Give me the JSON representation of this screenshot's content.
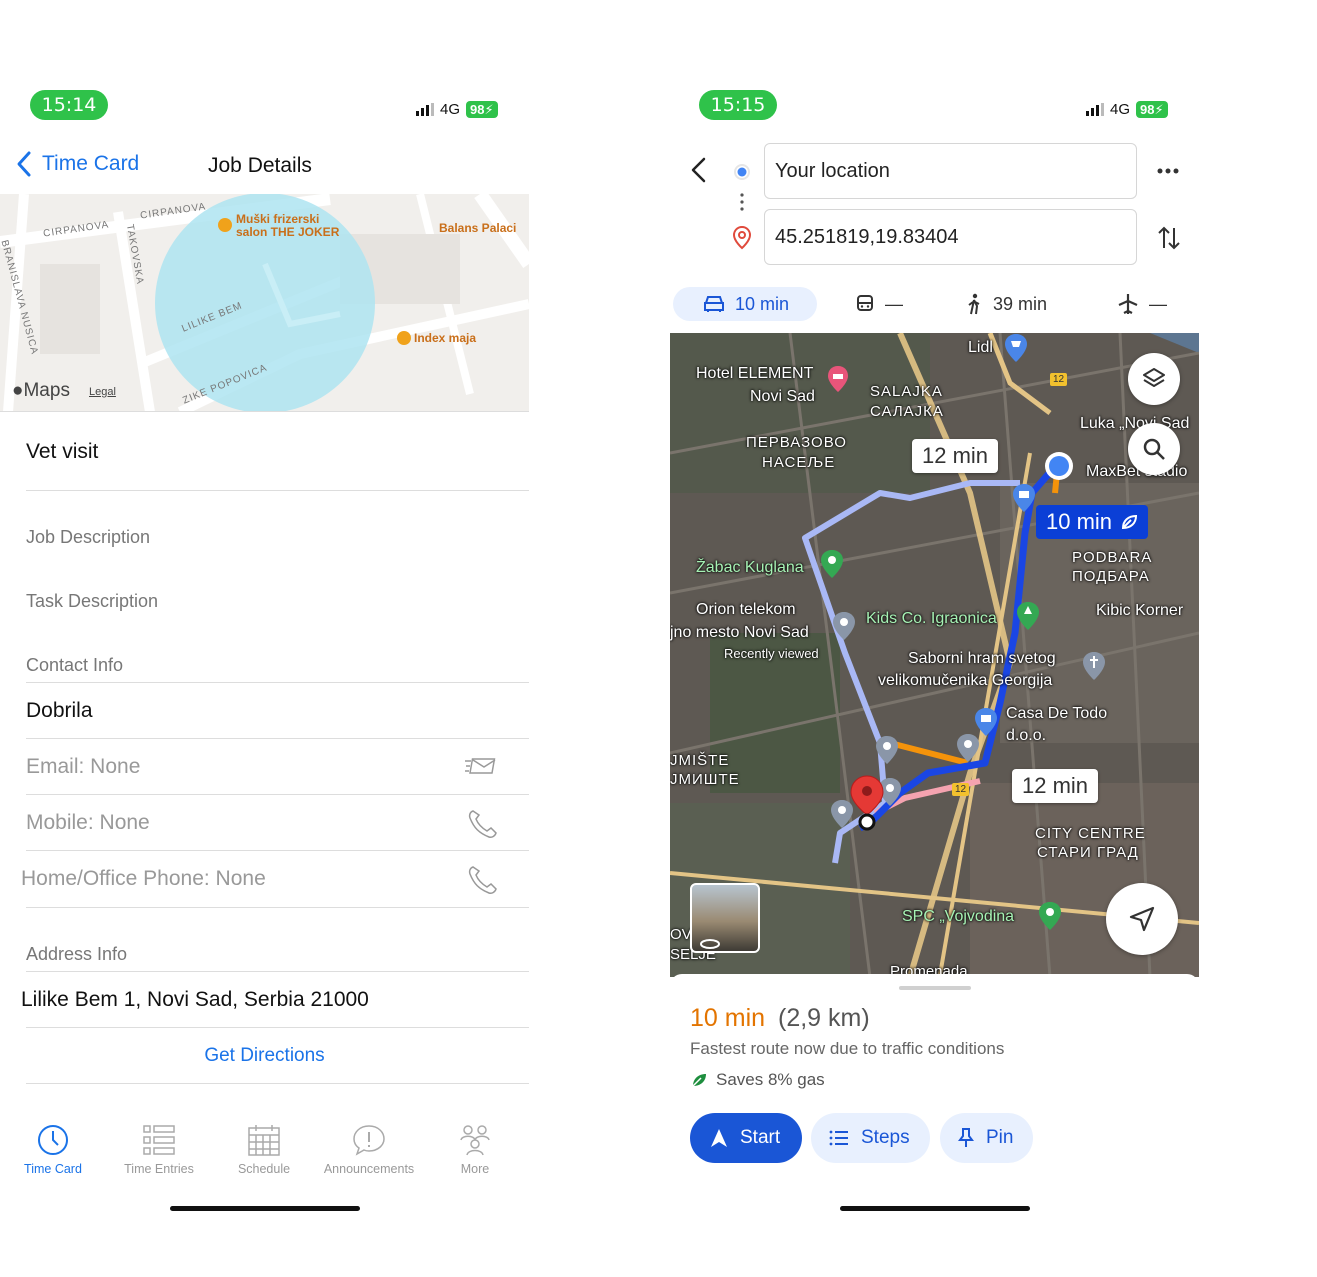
{
  "left": {
    "status": {
      "time": "15:14",
      "network": "4G",
      "battery": "98"
    },
    "nav": {
      "back_label": "Time Card",
      "title": "Job Details"
    },
    "map": {
      "streets": [
        "CIRPANOVA",
        "CIRPANOVA",
        "TAKOVSKA",
        "BRANISLAVA NUSICA",
        "LILIKE BEM",
        "ZIKE POPOVICA"
      ],
      "pois": {
        "joker_line1": "Muški frizerski",
        "joker_line2": "salon THE JOKER",
        "balans": "Balans Palaci",
        "index": "Index maja"
      },
      "logo": "Maps",
      "legal": "Legal"
    },
    "job_title": "Vet visit",
    "sections": {
      "job_description": "Job Description",
      "task_description": "Task Description",
      "contact_info": "Contact Info",
      "address_info": "Address Info"
    },
    "contact": {
      "name": "Dobrila",
      "email": "Email: None",
      "mobile": "Mobile: None",
      "home_phone": "Home/Office Phone: None"
    },
    "address": "Lilike Bem 1, Novi Sad, Serbia 21000",
    "get_directions": "Get Directions",
    "tabs": [
      {
        "label": "Time Card",
        "icon": "clock-icon"
      },
      {
        "label": "Time Entries",
        "icon": "list-icon"
      },
      {
        "label": "Schedule",
        "icon": "calendar-icon"
      },
      {
        "label": "Announcements",
        "icon": "chat-bubble-icon"
      },
      {
        "label": "More",
        "icon": "people-icon"
      }
    ],
    "accent": "#1a73e8"
  },
  "right": {
    "status": {
      "time": "15:15",
      "network": "4G",
      "battery": "98"
    },
    "origin": "Your location",
    "destination": "45.251819,19.83404",
    "modes": [
      {
        "name": "drive",
        "value": "10 min",
        "icon": "car-icon"
      },
      {
        "name": "transit",
        "value": "—",
        "icon": "train-icon"
      },
      {
        "name": "walk",
        "value": "39 min",
        "icon": "walk-icon"
      },
      {
        "name": "flight",
        "value": "—",
        "icon": "plane-icon"
      }
    ],
    "map": {
      "labels": {
        "lidl": "Lidl",
        "hotel1": "Hotel ELEMENT",
        "hotel2": "Novi Sad",
        "salajka1": "SALAJKA",
        "salajka2": "САЛАЈКА",
        "luka": "Luka „Novi Sad",
        "pervazovo1": "ПЕРВАЗОВО",
        "pervazovo2": "НАСЕЉЕ",
        "maxbet": "MaxBet stadio",
        "podbara1": "PODBARA",
        "podbara2": "ПОДБАРА",
        "zabac": "Žabac Kuglana",
        "orion": "Orion telekom",
        "kibic": "Kibic Korner",
        "kids": "Kids Co. Igraonica",
        "mesto": "jno mesto Novi Sad",
        "recent": "Recently viewed",
        "saborni1": "Saborni hram svetog",
        "saborni2": "velikomučenika Georgija",
        "casa1": "Casa De Todo",
        "casa2": "d.o.o.",
        "ajmiste1": "JMIŠTE",
        "ajmiste2": "ЈМИШТЕ",
        "centre1": "CITY CENTRE",
        "centre2": "СТАРИ ГРАД",
        "spc": "SPC „Vojvodina",
        "ov1": "OV",
        "ov2": "SELJE",
        "bottom": "Promenada"
      },
      "route_primary": "10 min",
      "route_alt1": "12 min",
      "route_alt2": "12 min",
      "road_badge": "12"
    },
    "summary": {
      "duration": "10 min",
      "distance": "(2,9 km)",
      "note": "Fastest route now due to traffic conditions",
      "eco": "Saves 8% gas"
    },
    "buttons": {
      "start": "Start",
      "steps": "Steps",
      "pin": "Pin"
    },
    "accent": "#1a56d6",
    "eta_color": "#e37400"
  }
}
